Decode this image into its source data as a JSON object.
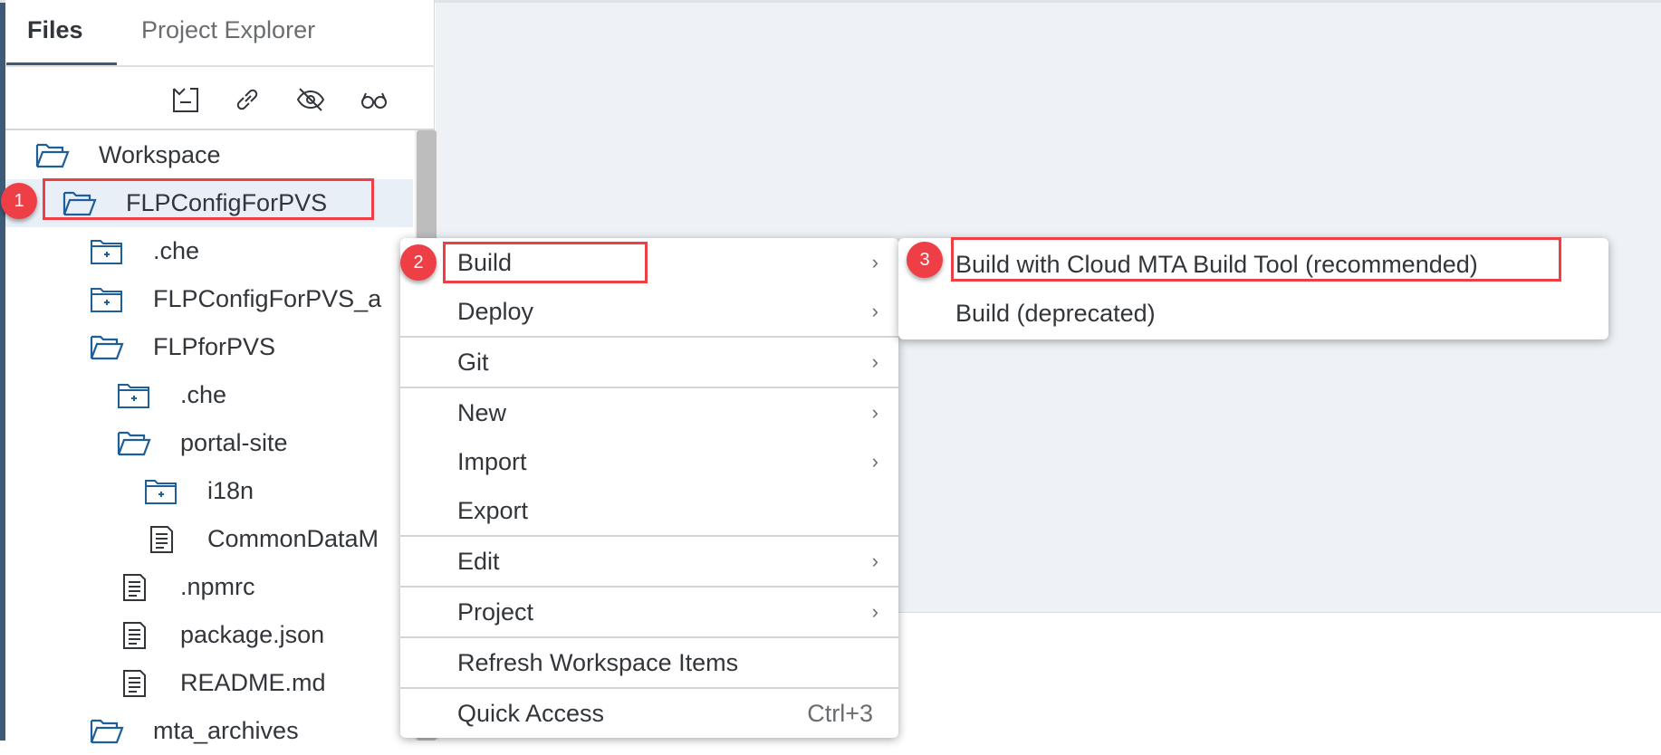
{
  "tabs": [
    {
      "label": "Files",
      "active": true
    },
    {
      "label": "Project Explorer",
      "active": false
    }
  ],
  "toolbar": [
    "collapse-all-icon",
    "link-icon",
    "hide-icon",
    "binoculars-icon"
  ],
  "tree": [
    {
      "label": "Workspace",
      "type": "folder-open",
      "level": 0
    },
    {
      "label": "FLPConfigForPVS",
      "type": "folder-open",
      "level": 1,
      "selected": true
    },
    {
      "label": ".che",
      "type": "folder-closed",
      "level": 2
    },
    {
      "label": "FLPConfigForPVS_a",
      "type": "folder-closed",
      "level": 2
    },
    {
      "label": "FLPforPVS",
      "type": "folder-open",
      "level": 2
    },
    {
      "label": ".che",
      "type": "folder-closed",
      "level": 3
    },
    {
      "label": "portal-site",
      "type": "folder-open",
      "level": 3
    },
    {
      "label": "i18n",
      "type": "folder-closed",
      "level": 4
    },
    {
      "label": "CommonDataM",
      "type": "file",
      "level": 4
    },
    {
      "label": ".npmrc",
      "type": "file",
      "level": 3
    },
    {
      "label": "package.json",
      "type": "file",
      "level": 3
    },
    {
      "label": "README.md",
      "type": "file",
      "level": 3
    },
    {
      "label": "mta_archives",
      "type": "folder-open",
      "level": 2
    }
  ],
  "context_menu": {
    "items": [
      {
        "label": "Build",
        "submenu": true
      },
      {
        "label": "Deploy",
        "submenu": true,
        "sep_after": true
      },
      {
        "label": "Git",
        "submenu": true,
        "sep_after": true
      },
      {
        "label": "New",
        "submenu": true
      },
      {
        "label": "Import",
        "submenu": true
      },
      {
        "label": "Export",
        "submenu": false,
        "sep_after": true
      },
      {
        "label": "Edit",
        "submenu": true,
        "sep_after": true
      },
      {
        "label": "Project",
        "submenu": true,
        "sep_after": true
      },
      {
        "label": "Refresh Workspace Items",
        "submenu": false,
        "sep_after": true
      },
      {
        "label": "Quick Access",
        "submenu": false,
        "shortcut": "Ctrl+3"
      }
    ]
  },
  "submenu": {
    "items": [
      {
        "label": "Build with Cloud MTA Build Tool (recommended)"
      },
      {
        "label": "Build (deprecated)"
      }
    ]
  },
  "annotations": {
    "step1": "1",
    "step2": "2",
    "step3": "3",
    "color": "#ef3f46"
  },
  "colors": {
    "accent": "#3d5a78",
    "folder": "#1f5f99",
    "selected_row": "#e8eff7"
  }
}
